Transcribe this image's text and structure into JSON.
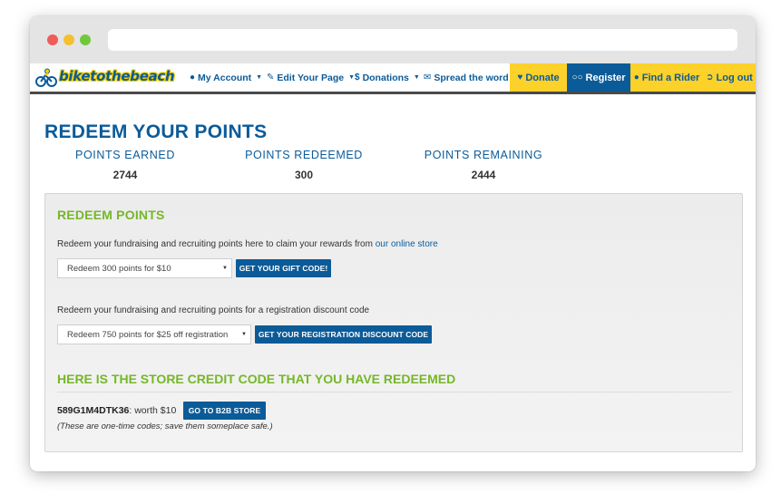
{
  "nav": {
    "logo_text": "biketothebeach",
    "my_account": "My Account",
    "edit_page": "Edit Your Page",
    "donations": "Donations",
    "spread_word": "Spread the word",
    "donate": "Donate",
    "register": "Register",
    "find_rider": "Find a Rider",
    "logout": "Log out"
  },
  "page": {
    "title": "REDEEM YOUR POINTS"
  },
  "stats": [
    {
      "label": "POINTS EARNED",
      "value": "2744"
    },
    {
      "label": "POINTS REDEEMED",
      "value": "300"
    },
    {
      "label": "POINTS REMAINING",
      "value": "2444"
    }
  ],
  "redeem": {
    "title": "REDEEM POINTS",
    "store_desc": "Redeem your fundraising and recruiting points here to claim your rewards from ",
    "store_link": "our online store",
    "gift_select": "Redeem 300 points for $10",
    "gift_button": "GET YOUR GIFT CODE!",
    "reg_desc": "Redeem your fundraising and recruiting points for a registration discount code",
    "reg_select": "Redeem 750 points for $25 off registration",
    "reg_button": "GET YOUR REGISTRATION DISCOUNT CODE"
  },
  "credit": {
    "title": "HERE IS THE STORE CREDIT CODE THAT YOU HAVE REDEEMED",
    "code": "589G1M4DTK36",
    "worth": ":  worth $10",
    "button": "GO TO B2B STORE",
    "note": "(These are one-time codes; save them someplace safe.)"
  },
  "colors": {
    "brand_blue": "#0b5b99",
    "brand_yellow": "#fcd12a",
    "accent_green": "#76b729"
  }
}
